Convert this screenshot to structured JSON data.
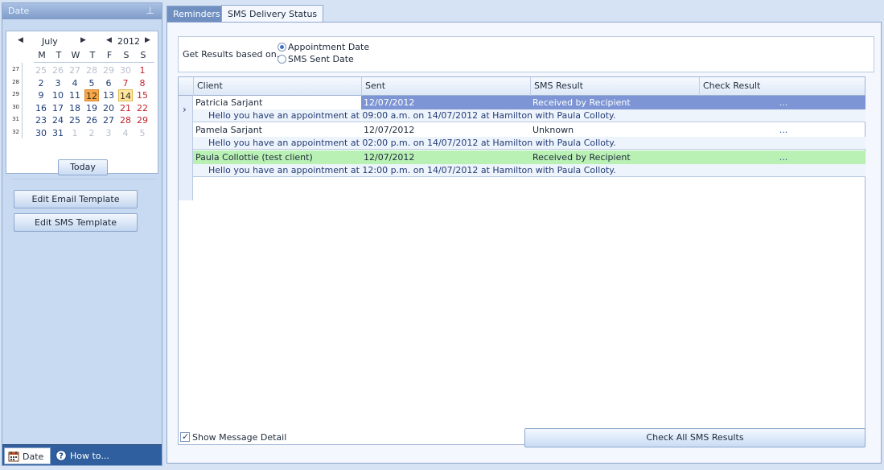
{
  "left_panel": {
    "title": "Date",
    "calendar": {
      "month": "July",
      "year": "2012",
      "days_of_week": [
        "M",
        "T",
        "W",
        "T",
        "F",
        "S",
        "S"
      ],
      "weeks": [
        {
          "week": "27",
          "days": [
            {
              "d": "25",
              "t": "other"
            },
            {
              "d": "26",
              "t": "other"
            },
            {
              "d": "27",
              "t": "other"
            },
            {
              "d": "28",
              "t": "other"
            },
            {
              "d": "29",
              "t": "other"
            },
            {
              "d": "30",
              "t": "other"
            },
            {
              "d": "1",
              "t": "wkend"
            }
          ]
        },
        {
          "week": "28",
          "days": [
            {
              "d": "2",
              "t": ""
            },
            {
              "d": "3",
              "t": ""
            },
            {
              "d": "4",
              "t": ""
            },
            {
              "d": "5",
              "t": ""
            },
            {
              "d": "6",
              "t": ""
            },
            {
              "d": "7",
              "t": "wkend"
            },
            {
              "d": "8",
              "t": "wkend"
            }
          ]
        },
        {
          "week": "29",
          "days": [
            {
              "d": "9",
              "t": ""
            },
            {
              "d": "10",
              "t": ""
            },
            {
              "d": "11",
              "t": ""
            },
            {
              "d": "12",
              "t": "selected"
            },
            {
              "d": "13",
              "t": ""
            },
            {
              "d": "14",
              "t": "today"
            },
            {
              "d": "15",
              "t": "wkend"
            }
          ]
        },
        {
          "week": "30",
          "days": [
            {
              "d": "16",
              "t": ""
            },
            {
              "d": "17",
              "t": ""
            },
            {
              "d": "18",
              "t": ""
            },
            {
              "d": "19",
              "t": ""
            },
            {
              "d": "20",
              "t": ""
            },
            {
              "d": "21",
              "t": "wkend"
            },
            {
              "d": "22",
              "t": "wkend"
            }
          ]
        },
        {
          "week": "31",
          "days": [
            {
              "d": "23",
              "t": ""
            },
            {
              "d": "24",
              "t": ""
            },
            {
              "d": "25",
              "t": ""
            },
            {
              "d": "26",
              "t": ""
            },
            {
              "d": "27",
              "t": ""
            },
            {
              "d": "28",
              "t": "wkend"
            },
            {
              "d": "29",
              "t": "wkend"
            }
          ]
        },
        {
          "week": "32",
          "days": [
            {
              "d": "30",
              "t": ""
            },
            {
              "d": "31",
              "t": ""
            },
            {
              "d": "1",
              "t": "other"
            },
            {
              "d": "2",
              "t": "other"
            },
            {
              "d": "3",
              "t": "other"
            },
            {
              "d": "4",
              "t": "other"
            },
            {
              "d": "5",
              "t": "other"
            }
          ]
        }
      ],
      "today_label": "Today"
    },
    "edit_email_label": "Edit Email Template",
    "edit_sms_label": "Edit SMS Template",
    "bottom_tabs": [
      {
        "label": "Date",
        "icon": "calendar-icon"
      },
      {
        "label": "How to...",
        "icon": "help-icon"
      }
    ]
  },
  "tabs": [
    {
      "label": "Reminders"
    },
    {
      "label": "SMS Delivery Status"
    }
  ],
  "filter": {
    "label": "Get Results based on...",
    "options": [
      {
        "label": "Appointment Date",
        "checked": true
      },
      {
        "label": "SMS Sent Date",
        "checked": false
      }
    ]
  },
  "grid": {
    "columns": [
      "Client",
      "Sent",
      "SMS Result",
      "Check Result"
    ],
    "rows": [
      {
        "client": "Patricia Sarjant",
        "sent": "12/07/2012",
        "result": "Received by Recipient",
        "check": "...",
        "state": "selected",
        "detail": "Hello you have an appointment at 09:00 a.m. on  14/07/2012 at Hamilton with Paula Colloty."
      },
      {
        "client": "Pamela Sarjant",
        "sent": "12/07/2012",
        "result": "Unknown",
        "check": "...",
        "state": "",
        "detail": "Hello you have an appointment at 02:00 p.m. on  14/07/2012 at Hamilton with Paula Colloty."
      },
      {
        "client": "Paula Collottie (test client)",
        "sent": "12/07/2012",
        "result": "Received by Recipient",
        "check": "...",
        "state": "green",
        "detail": "Hello you have an appointment at 12:00 p.m. on  14/07/2012 at Hamilton with Paula Colloty."
      }
    ]
  },
  "show_detail_label": "Show Message Detail",
  "show_detail_checked": true,
  "check_all_label": "Check All SMS Results",
  "colors": {
    "selected_row": "#7d95d4",
    "received_row": "#b9f0b4",
    "weekend_text": "#c0232b"
  }
}
